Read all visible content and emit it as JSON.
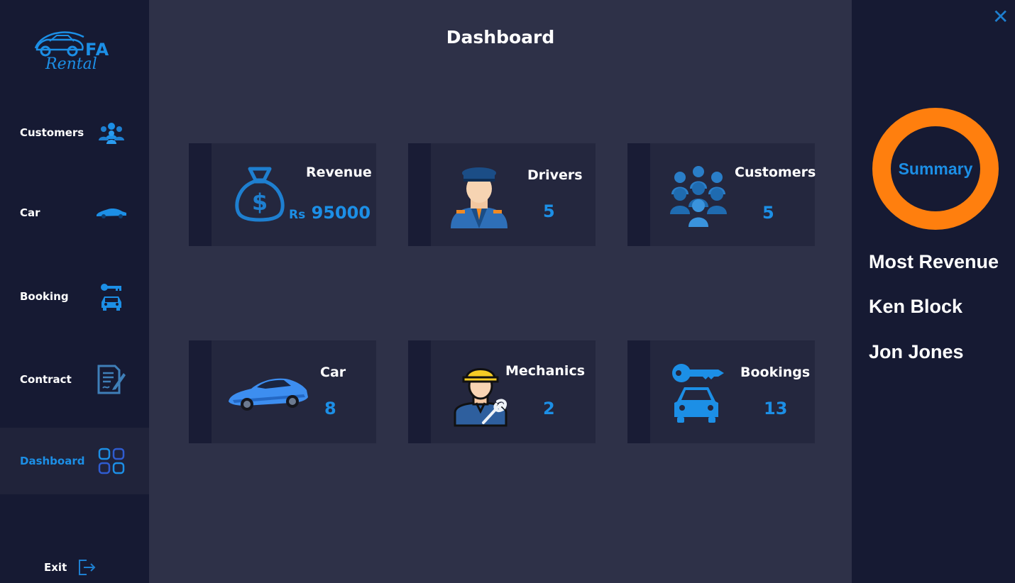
{
  "app": {
    "logo_short": "FA",
    "logo_name": "Rental"
  },
  "sidebar": {
    "items": [
      {
        "label": "Customers",
        "icon": "people-icon",
        "active": false
      },
      {
        "label": "Car",
        "icon": "car-icon",
        "active": false
      },
      {
        "label": "Booking",
        "icon": "key-car-icon",
        "active": false
      },
      {
        "label": "Contract",
        "icon": "contract-icon",
        "active": false
      },
      {
        "label": "Dashboard",
        "icon": "dashboard-grid-icon",
        "active": true
      }
    ],
    "exit_label": "Exit"
  },
  "main": {
    "title": "Dashboard",
    "cards": [
      {
        "title": "Revenue",
        "currency": "Rs",
        "value": "95000",
        "icon": "money-bag-icon"
      },
      {
        "title": "Drivers",
        "value": "5",
        "icon": "driver-icon"
      },
      {
        "title": "Customers",
        "value": "5",
        "icon": "customers-group-icon"
      },
      {
        "title": "Car",
        "value": "8",
        "icon": "sports-car-icon"
      },
      {
        "title": "Mechanics",
        "value": "2",
        "icon": "mechanic-icon"
      },
      {
        "title": "Bookings",
        "value": "13",
        "icon": "key-car-icon"
      }
    ]
  },
  "summary": {
    "ring_label": "Summary",
    "heading": "Most Revenue",
    "names": [
      "Ken Block",
      "Jon Jones"
    ]
  },
  "colors": {
    "accent": "#1c8fe6",
    "ring": "#ff7f0e",
    "sidebar": "#161a33",
    "main": "#2e3148",
    "card": "#24273e"
  }
}
